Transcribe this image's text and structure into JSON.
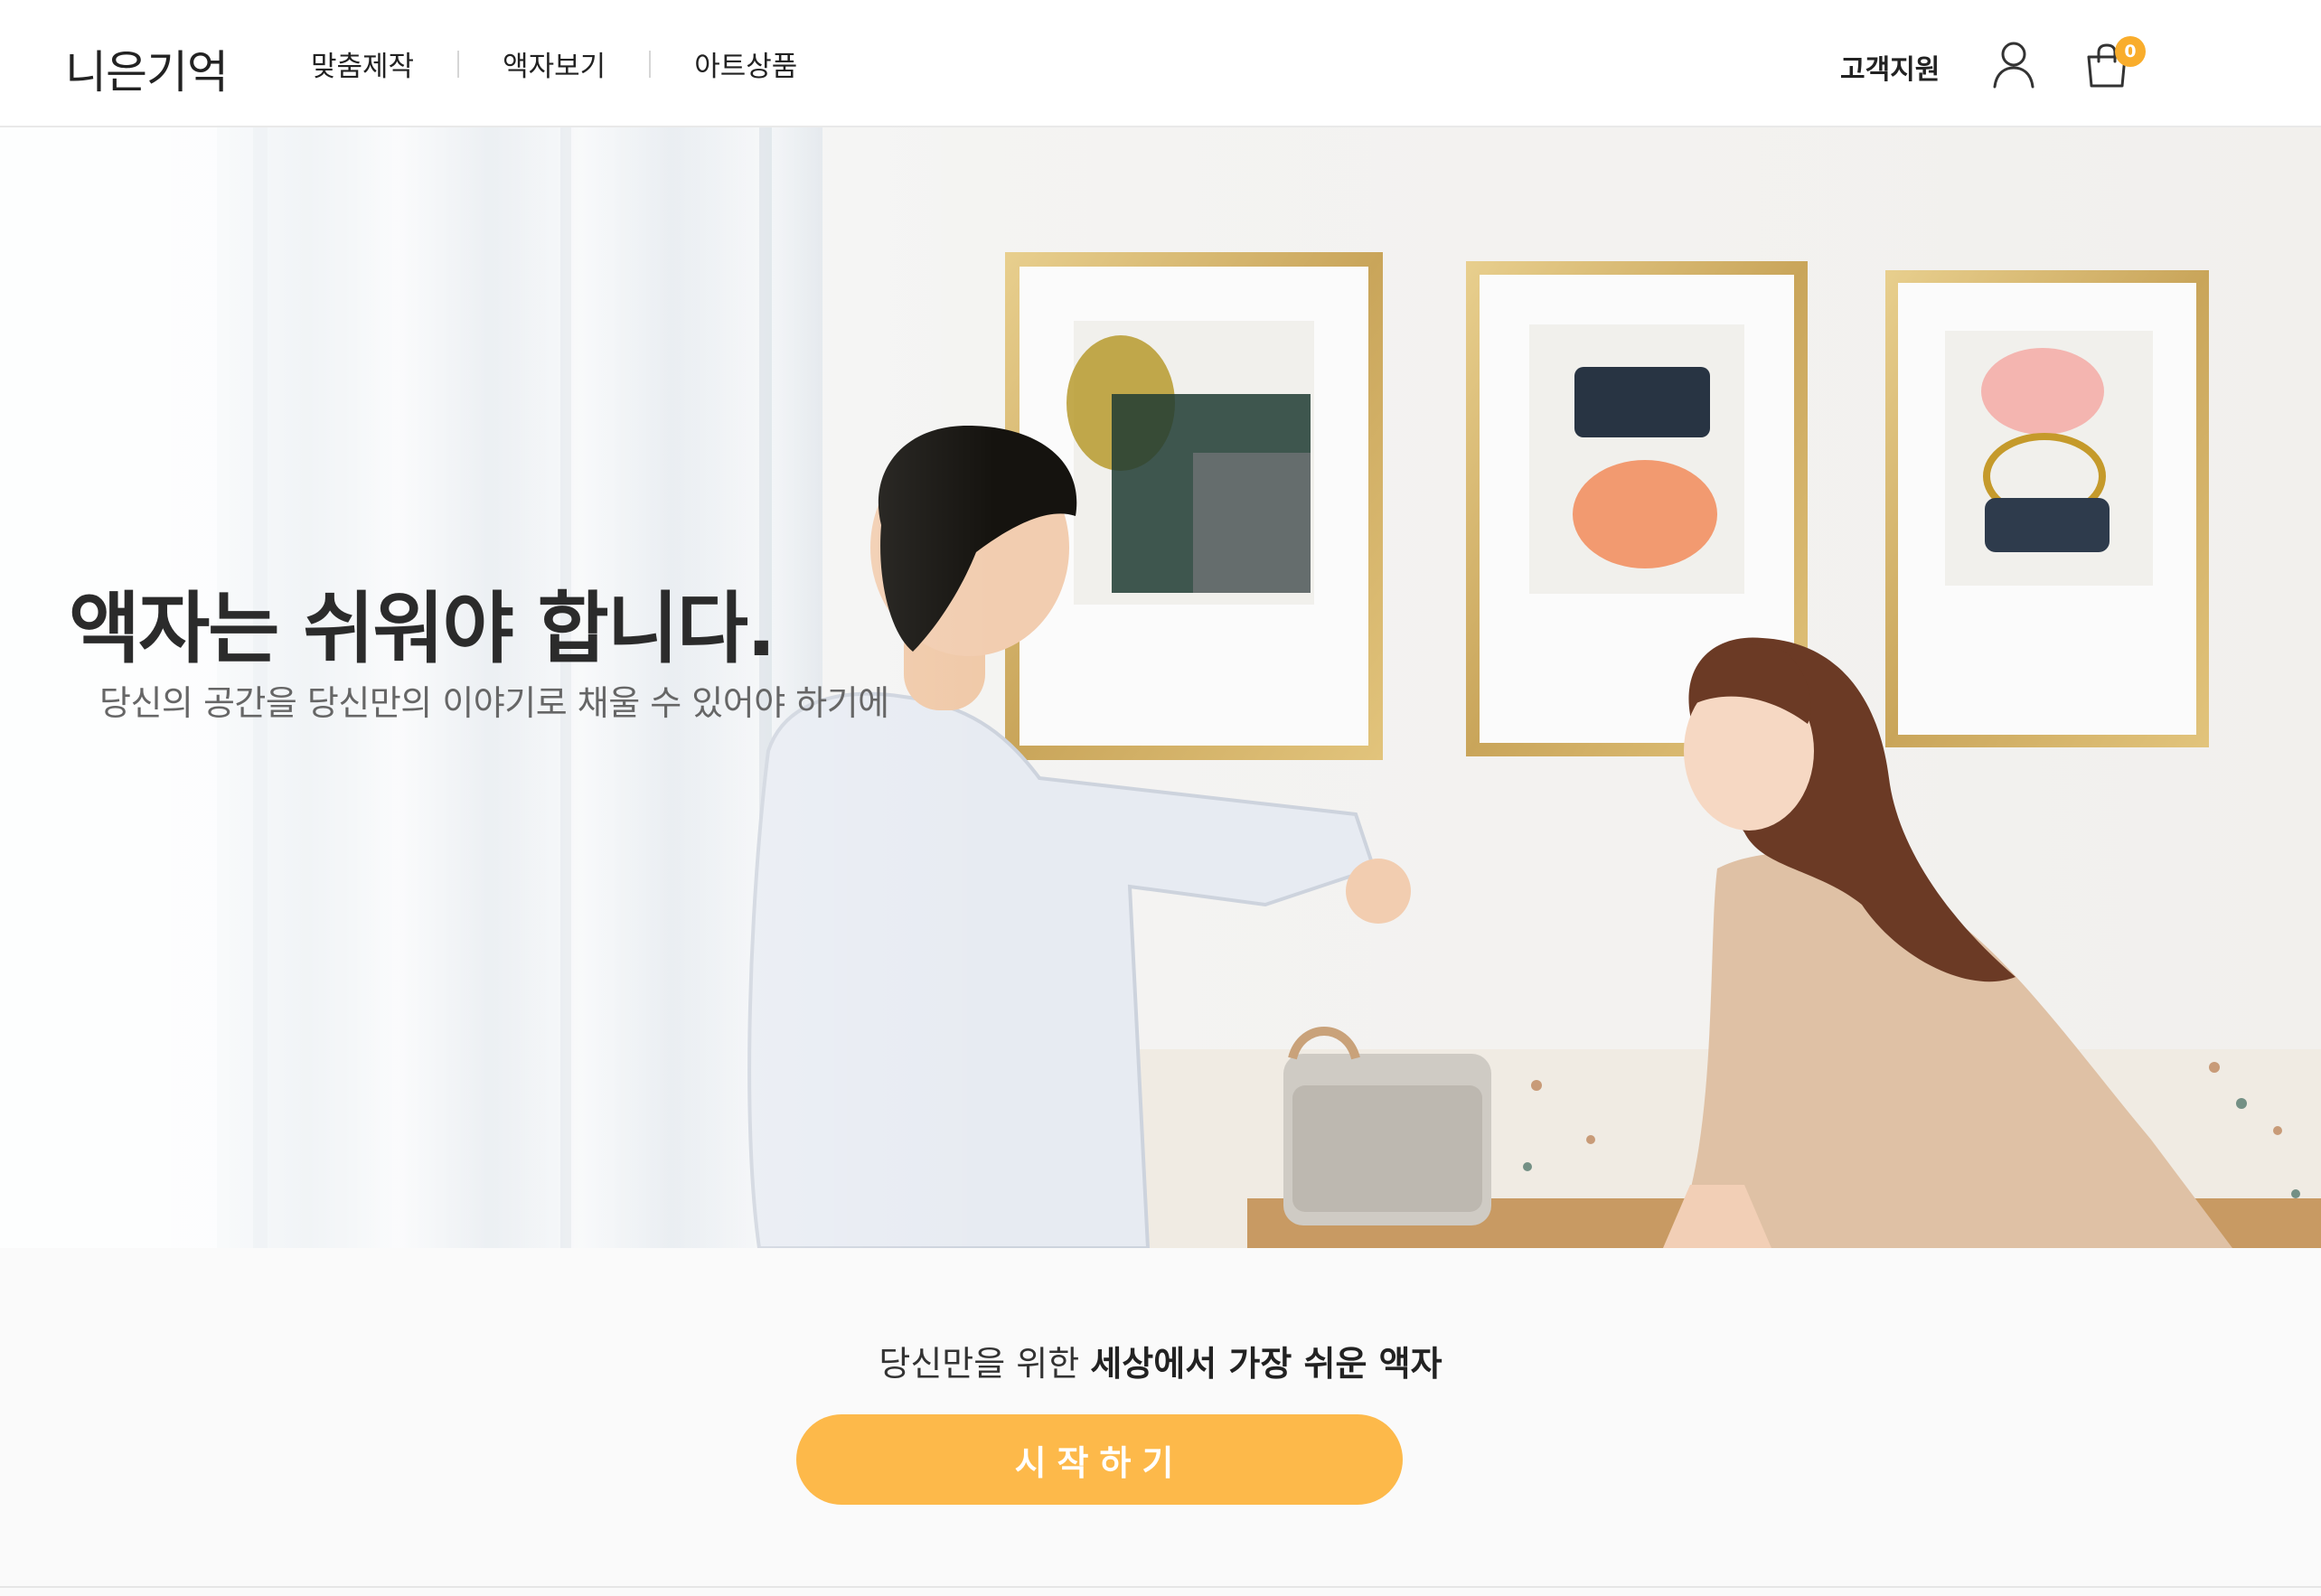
{
  "header": {
    "logo": "니은기억",
    "nav": [
      "맞춤제작",
      "액자보기",
      "아트상품"
    ],
    "support_label": "고객지원",
    "cart_count": "0",
    "icons": {
      "user": "user-icon",
      "cart": "shopping-bag-icon"
    }
  },
  "hero": {
    "title": "액자는 쉬워야 합니다.",
    "subtitle": "당신의 공간을 당신만의 이야기로 채울 수 있어야 하기에"
  },
  "cta": {
    "text_normal": "당신만을 위한 ",
    "text_bold": "세상에서 가장 쉬운 액자",
    "button_label": "시작하기"
  },
  "colors": {
    "accent": "#fdb94a",
    "badge": "#f9ad2c",
    "text_dark": "#222222",
    "text_gray": "#666666"
  }
}
